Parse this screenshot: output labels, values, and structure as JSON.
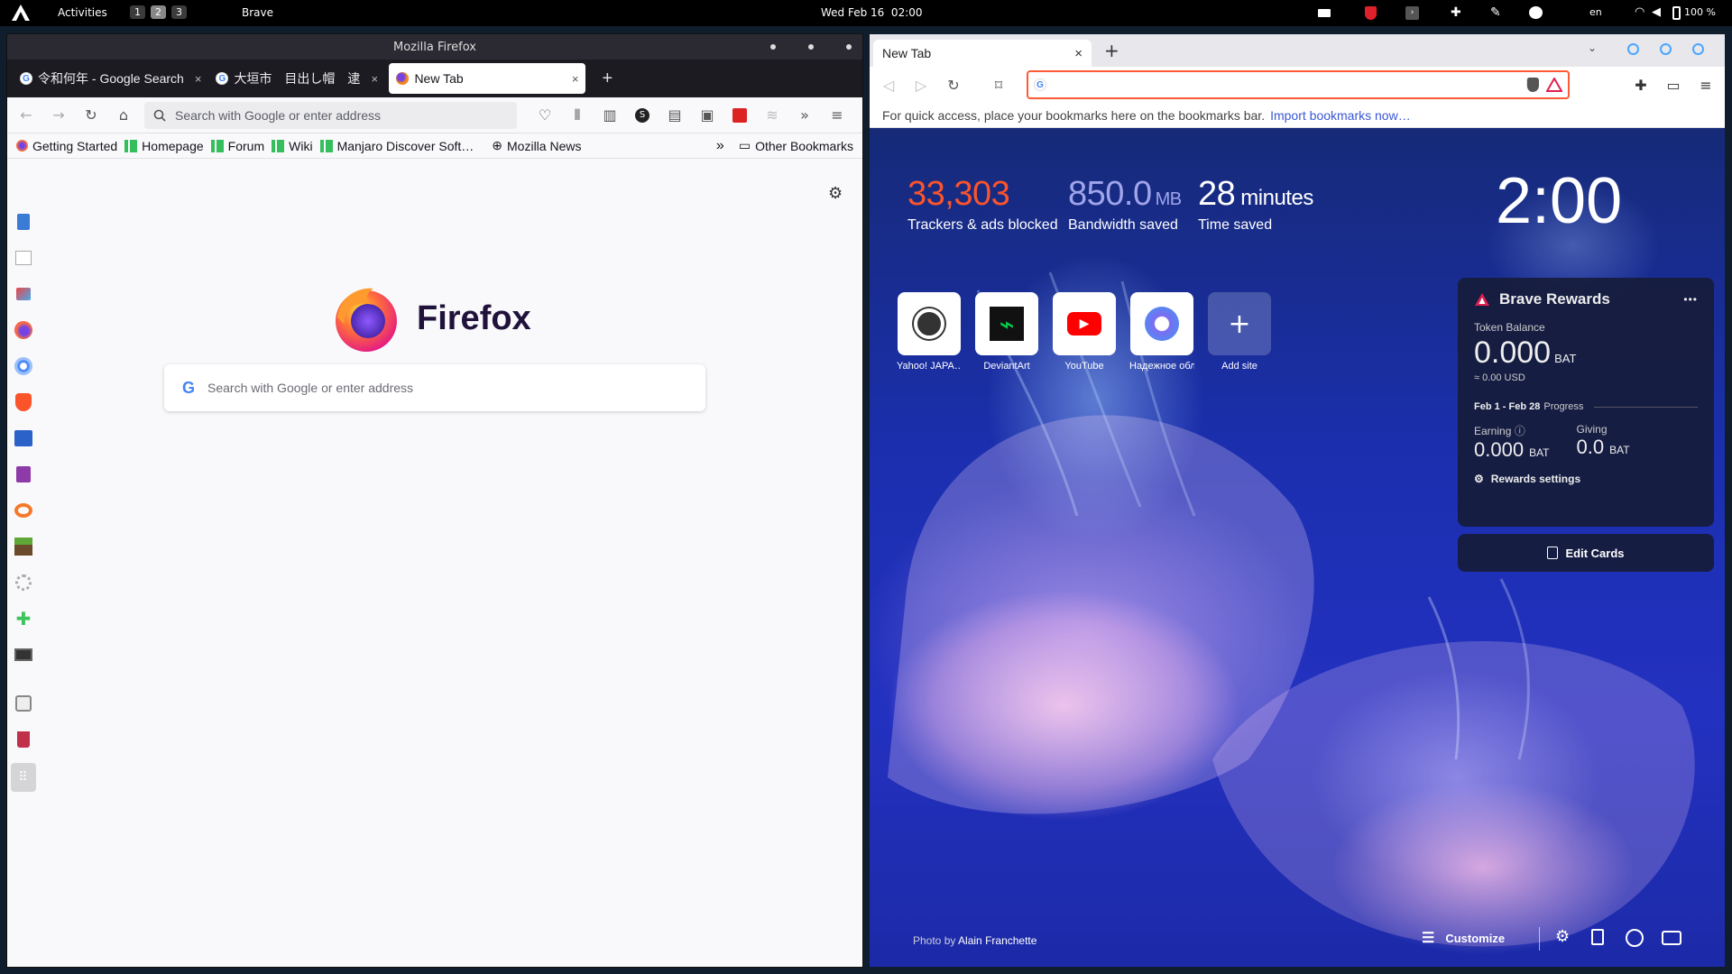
{
  "topbar": {
    "activities": "Activities",
    "workspaces": [
      "1",
      "2",
      "3"
    ],
    "app_name": "Brave",
    "clock": "Wed Feb 16  02:00",
    "language": "en",
    "battery": "100 %"
  },
  "firefox": {
    "window_title": "Mozilla Firefox",
    "tabs": [
      {
        "label": "令和何年 - Google Search",
        "close": "×"
      },
      {
        "label": "大垣市　目出し帽　逮捕",
        "close": "×"
      },
      {
        "label": "New Tab",
        "close": "×"
      }
    ],
    "new_tab": "+",
    "url_placeholder": "Search with Google or enter address",
    "bookmarks": [
      "Getting Started",
      "Homepage",
      "Forum",
      "Wiki",
      "Manjaro Discover Soft…",
      "Mozilla News"
    ],
    "bookmarks_overflow": "»",
    "other_bookmarks": "Other Bookmarks",
    "brand": "Firefox",
    "search_placeholder": "Search with Google or enter address"
  },
  "brave": {
    "tab_title": "New Tab",
    "tab_close": "×",
    "new_tab": "+",
    "bookmarks_bar_text": "For quick access, place your bookmarks here on the bookmarks bar.",
    "import_link": "Import bookmarks now…",
    "stats": [
      {
        "value": "33,303",
        "unit": "",
        "label": "Trackers & ads blocked",
        "color": "#fb542b"
      },
      {
        "value": "850.0",
        "unit": "MB",
        "label": "Bandwidth saved",
        "color": "#a0a5eb"
      },
      {
        "value": "28",
        "unit": "minutes",
        "label": "Time saved",
        "color": "#ffffff"
      }
    ],
    "clock": "2:00",
    "top_sites": [
      "Yahoo! JAPA…",
      "DeviantArt",
      "YouTube",
      "Надежное обл…",
      "Add site"
    ],
    "rewards": {
      "title": "Brave Rewards",
      "menu": "•••",
      "token_balance_label": "Token Balance",
      "balance": "0.000",
      "balance_unit": "BAT",
      "usd": "≈ 0.00 USD",
      "period": "Feb 1 - Feb 28",
      "progress_label": "Progress",
      "earning_label": "Earning",
      "earning": "0.000",
      "earning_unit": "BAT",
      "giving_label": "Giving",
      "giving": "0.0",
      "giving_unit": "BAT",
      "settings_label": "Rewards settings"
    },
    "edit_cards": "Edit Cards",
    "photo_credit_prefix": "Photo by",
    "photo_credit_name": "Alain Franchette",
    "customize": "Customize"
  }
}
